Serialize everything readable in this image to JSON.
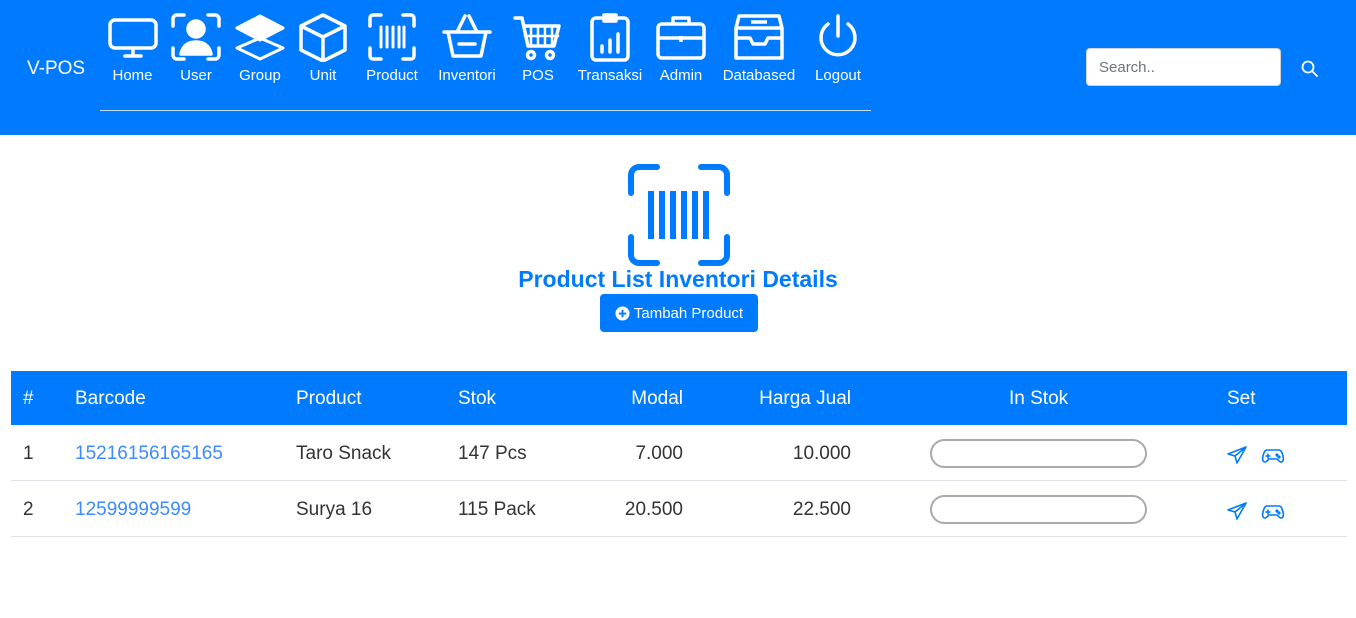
{
  "brand": "V-POS",
  "nav": [
    {
      "label": "Home",
      "icon": "monitor-icon"
    },
    {
      "label": "User",
      "icon": "user-icon"
    },
    {
      "label": "Group",
      "icon": "layers-icon"
    },
    {
      "label": "Unit",
      "icon": "box-icon"
    },
    {
      "label": "Product",
      "icon": "barcode-icon"
    },
    {
      "label": "Inventori",
      "icon": "basket-icon"
    },
    {
      "label": "POS",
      "icon": "cart-icon"
    },
    {
      "label": "Transaksi",
      "icon": "report-icon"
    },
    {
      "label": "Admin",
      "icon": "briefcase-icon"
    },
    {
      "label": "Databased",
      "icon": "inbox-icon"
    },
    {
      "label": "Logout",
      "icon": "power-icon"
    }
  ],
  "search": {
    "placeholder": "Search.."
  },
  "page": {
    "title": "Product List Inventori Details",
    "add_button": "Tambah Product"
  },
  "table": {
    "headers": {
      "no": "#",
      "barcode": "Barcode",
      "product": "Product",
      "stok": "Stok",
      "modal": "Modal",
      "harga_jual": "Harga Jual",
      "in_stok": "In Stok",
      "set": "Set"
    },
    "rows": [
      {
        "no": "1",
        "barcode": "15216156165165",
        "product": "Taro Snack",
        "stok": "147 Pcs",
        "modal": "7.000",
        "harga_jual": "10.000"
      },
      {
        "no": "2",
        "barcode": "12599999599",
        "product": "Surya 16",
        "stok": "115 Pack",
        "modal": "20.500",
        "harga_jual": "22.500"
      }
    ]
  },
  "colors": {
    "primary": "#007bff",
    "link": "#3d8bfd"
  }
}
